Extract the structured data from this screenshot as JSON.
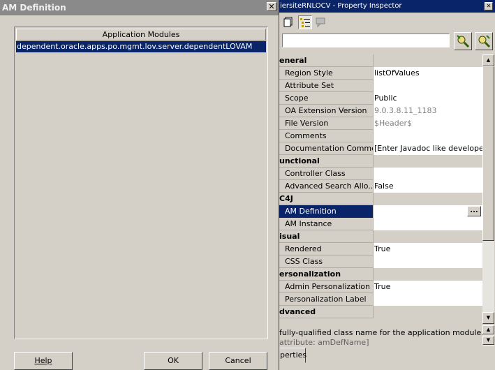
{
  "dialog": {
    "title": "AM Definition",
    "close_glyph": "✕",
    "list_header": "Application Modules",
    "items": [
      "dependent.oracle.apps.po.mgmt.lov.server.dependentLOVAM"
    ],
    "help_label": "Help",
    "ok_label": "OK",
    "cancel_label": "Cancel"
  },
  "inspector": {
    "title": "iersiteRNLOCV - Property Inspector",
    "search_value": "",
    "rows": {
      "general": "eneral",
      "region_style": {
        "name": "Region Style",
        "value": "listOfValues"
      },
      "attribute_set": {
        "name": "Attribute Set",
        "value": ""
      },
      "scope": {
        "name": "Scope",
        "value": "Public"
      },
      "oa_ext_version": {
        "name": "OA Extension Version",
        "value": "9.0.3.8.11_1183"
      },
      "file_version": {
        "name": "File Version",
        "value": "$Header$"
      },
      "comments": {
        "name": "Comments",
        "value": ""
      },
      "doc_comment": {
        "name": "Documentation Comment",
        "value": "[Enter Javadoc like developer ..."
      },
      "functional": "unctional",
      "controller_class": {
        "name": "Controller Class",
        "value": ""
      },
      "adv_search": {
        "name": "Advanced Search Allo...",
        "value": "False"
      },
      "bc4j": "C4J",
      "am_definition": {
        "name": "AM Definition",
        "value": ""
      },
      "am_instance": {
        "name": "AM Instance",
        "value": ""
      },
      "visual": "isual",
      "rendered": {
        "name": "Rendered",
        "value": "True"
      },
      "css_class": {
        "name": "CSS Class",
        "value": ""
      },
      "personalization": "ersonalization",
      "admin_personalization": {
        "name": "Admin Personalization",
        "value": "True"
      },
      "personalization_label": {
        "name": "Personalization Label",
        "value": ""
      },
      "advanced": "dvanced"
    },
    "ellipsis_label": "...",
    "description_line1": "fully-qualified class name for the application module.",
    "description_line2": "attribute: amDefName]",
    "tab_label": "perties"
  },
  "colors": {
    "selection": "#0a246a",
    "panel": "#d4d0c8",
    "inactive_title": "#8a8a8a"
  }
}
